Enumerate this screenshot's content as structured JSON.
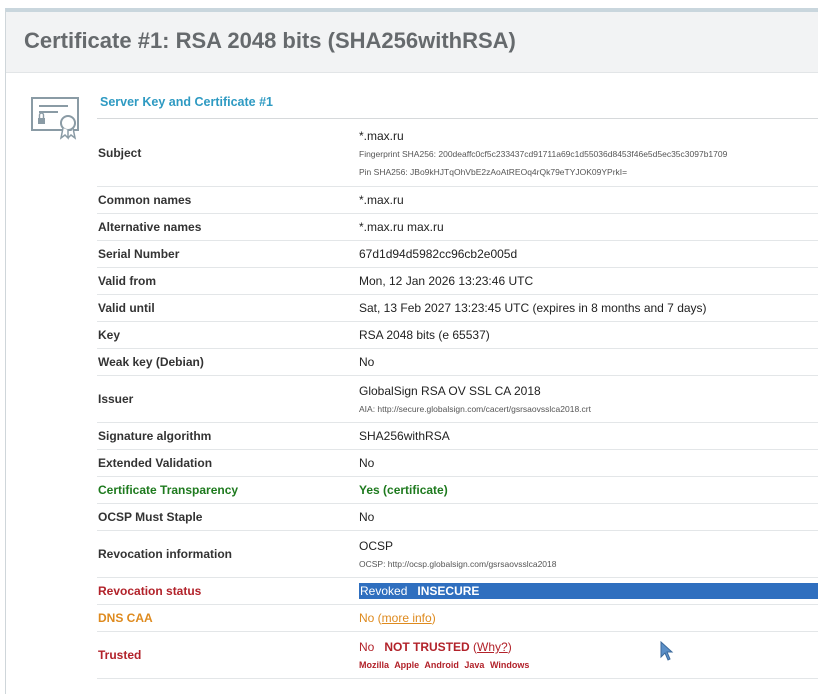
{
  "page": {
    "title": "Certificate #1: RSA 2048 bits (SHA256withRSA)",
    "section_title": "Server Key and Certificate #1"
  },
  "colors": {
    "accent_blue": "#2e9ac2",
    "good_green": "#1e7a1e",
    "bad_red": "#b2222a",
    "warn_orange": "#de8a1e",
    "selection_blue": "#2f6fbf"
  },
  "rows": {
    "subject": {
      "label": "Subject",
      "value": "*.max.ru",
      "fingerprint": "Fingerprint SHA256: 200deaffc0cf5c233437cd91711a69c1d55036d8453f46e5d5ec35c3097b1709",
      "pin": "Pin SHA256: JBo9kHJTqOhVbE2zAoAtREOq4rQk79eTYJOK09YPrkI="
    },
    "common_names": {
      "label": "Common names",
      "value": "*.max.ru"
    },
    "alternative_names": {
      "label": "Alternative names",
      "value": "*.max.ru max.ru"
    },
    "serial_number": {
      "label": "Serial Number",
      "value": "67d1d94d5982cc96cb2e005d"
    },
    "valid_from": {
      "label": "Valid from",
      "value": "Mon, 12 Jan 2026 13:23:46 UTC"
    },
    "valid_until": {
      "label": "Valid until",
      "value": "Sat, 13 Feb 2027 13:23:45 UTC (expires in 8 months and 7 days)"
    },
    "key": {
      "label": "Key",
      "value": "RSA 2048 bits (e 65537)"
    },
    "weak_key": {
      "label": "Weak key (Debian)",
      "value": "No"
    },
    "issuer": {
      "label": "Issuer",
      "value": "GlobalSign RSA OV SSL CA 2018",
      "aia": "AIA: http://secure.globalsign.com/cacert/gsrsaovsslca2018.crt"
    },
    "signature_algorithm": {
      "label": "Signature algorithm",
      "value": "SHA256withRSA"
    },
    "extended_validation": {
      "label": "Extended Validation",
      "value": "No"
    },
    "certificate_transparency": {
      "label": "Certificate Transparency",
      "value": "Yes (certificate)"
    },
    "ocsp_must_staple": {
      "label": "OCSP Must Staple",
      "value": "No"
    },
    "revocation_information": {
      "label": "Revocation information",
      "value": "OCSP",
      "ocsp": "OCSP: http://ocsp.globalsign.com/gsrsaovsslca2018"
    },
    "revocation_status": {
      "label": "Revocation status",
      "value_revoked": "Revoked",
      "value_insecure": "INSECURE"
    },
    "dns_caa": {
      "label": "DNS CAA",
      "value": "No (",
      "link": "more info",
      "value_end": ")"
    },
    "trusted": {
      "label": "Trusted",
      "value_no": "No",
      "value_not_trusted": "NOT TRUSTED",
      "why_open": "(",
      "why_link": "Why?",
      "why_close": ")",
      "clients": [
        "Mozilla",
        "Apple",
        "Android",
        "Java",
        "Windows"
      ]
    }
  }
}
